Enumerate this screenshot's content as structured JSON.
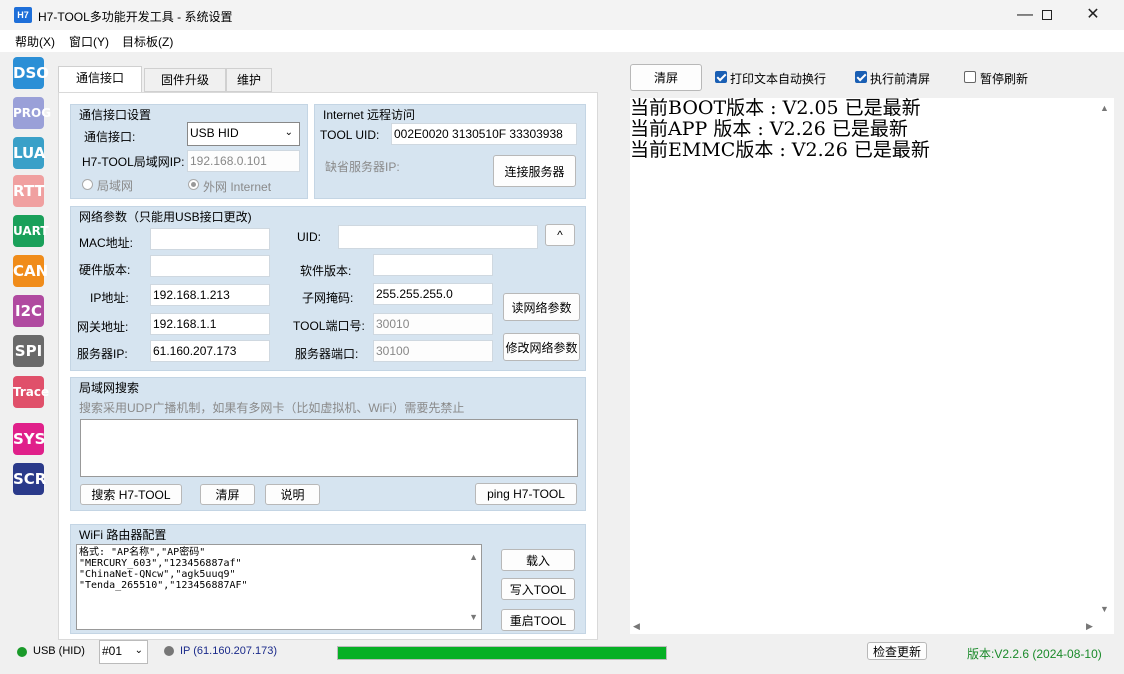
{
  "window": {
    "icon_text": "H7",
    "title": "H7-TOOL多功能开发工具 - 系统设置"
  },
  "menu": [
    "帮助(X)",
    "窗口(Y)",
    "目标板(Z)"
  ],
  "sidebar": [
    {
      "label": "DSO",
      "color": "#2b8fd6"
    },
    {
      "label": "PROG",
      "color": "#9aa0d8"
    },
    {
      "label": "LUA",
      "color": "#3aa0c8"
    },
    {
      "label": "RTT",
      "color": "#f0a0a0"
    },
    {
      "label": "UART",
      "color": "#1aa05a"
    },
    {
      "label": "CAN",
      "color": "#f08c1a"
    },
    {
      "label": "I2C",
      "color": "#b04aa0"
    },
    {
      "label": "SPI",
      "color": "#6a6a6a"
    },
    {
      "label": "Trace",
      "color": "#e0506a"
    },
    {
      "label": "SYS",
      "color": "#e0208a"
    },
    {
      "label": "SCR",
      "color": "#2a3a8a"
    }
  ],
  "tabs": [
    "通信接口",
    "固件升级",
    "维护"
  ],
  "comm": {
    "title": "通信接口设置",
    "iface_label": "通信接口:",
    "iface_value": "USB HID",
    "lan_ip_label": "H7-TOOL局域网IP:",
    "lan_ip_value": "192.168.0.101",
    "radio_lan": "局域网",
    "radio_wan": "外网 Internet"
  },
  "remote": {
    "title": "Internet 远程访问",
    "uid_label": "TOOL UID:",
    "uid_value": "002E0020 3130510F 33303938",
    "server_label": "缺省服务器IP:",
    "connect_button": "连接服务器"
  },
  "net": {
    "title": "网络参数（只能用USB接口更改)",
    "mac_label": "MAC地址:",
    "uid_label": "UID:",
    "uid_button": "^",
    "hw_label": "硬件版本:",
    "sw_label": "软件版本:",
    "ip_label": "IP地址:",
    "ip_value": "192.168.1.213",
    "mask_label": "子网掩码:",
    "mask_value": "255.255.255.0",
    "gw_label": "网关地址:",
    "gw_value": "192.168.1.1",
    "port_label": "TOOL端口号:",
    "port_value": "30010",
    "srv_label": "服务器IP:",
    "srv_value": "61.160.207.173",
    "srvport_label": "服务器端口:",
    "srvport_value": "30100",
    "read_button": "读网络参数",
    "modify_button": "修改网络参数"
  },
  "lan": {
    "title": "局域网搜索",
    "hint": "搜索采用UDP广播机制，如果有多网卡（比如虚拟机、WiFi）需要先禁止",
    "search_button": "搜索 H7-TOOL",
    "clear_button": "清屏",
    "help_button": "说明",
    "ping_button": "ping H7-TOOL"
  },
  "wifi": {
    "title": "WiFi 路由器配置",
    "text": "格式: \"AP名称\",\"AP密码\"\n\"MERCURY_603\",\"123456887af\"\n\"ChinaNet-QNcw\",\"agk5uuq9\"\n\"Tenda_265510\",\"123456887AF\"",
    "load_button": "载入",
    "write_button": "写入TOOL",
    "restart_button": "重启TOOL"
  },
  "right": {
    "clear_button": "清屏",
    "opt_wrap": "打印文本自动换行",
    "opt_clear": "执行前清屏",
    "opt_pause": "暂停刷新",
    "log": "当前BOOT版本 : V2.05 已是最新\n当前APP 版本 : V2.26 已是最新\n当前EMMC版本 : V2.26 已是最新"
  },
  "status": {
    "usb": "USB (HID)",
    "device": "#01",
    "ip": "IP (61.160.207.173)",
    "progress": 1.0,
    "check_update": "检查更新",
    "version": "版本:V2.2.6 (2024-08-10)"
  }
}
